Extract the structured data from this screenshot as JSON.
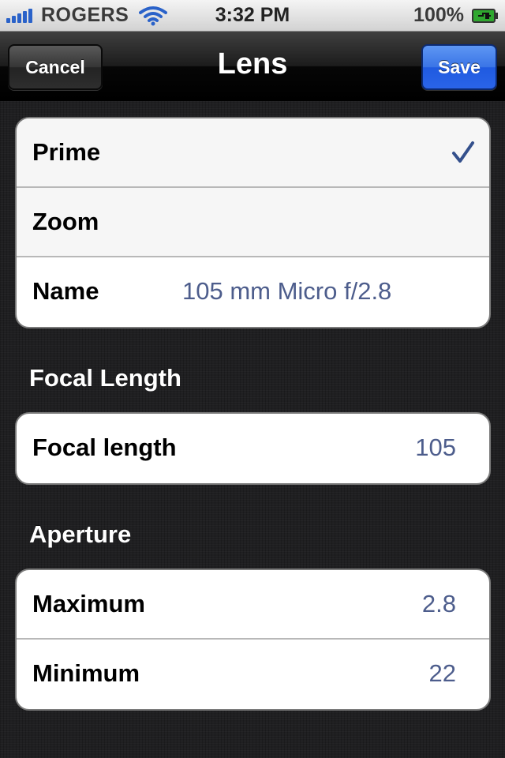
{
  "status_bar": {
    "carrier": "ROGERS",
    "time": "3:32 PM",
    "battery_percent": "100%",
    "icons": [
      "signal-icon",
      "wifi-icon",
      "battery-charging-icon"
    ]
  },
  "nav": {
    "cancel_label": "Cancel",
    "title": "Lens",
    "save_label": "Save",
    "save_color": "#2a64e8"
  },
  "lens_type": {
    "rows": [
      {
        "label": "Prime",
        "checked": true
      },
      {
        "label": "Zoom",
        "checked": false
      }
    ],
    "name": {
      "label": "Name",
      "value": "105 mm Micro f/2.8"
    }
  },
  "focal_length": {
    "header": "Focal Length",
    "row": {
      "label": "Focal length",
      "value": "105"
    }
  },
  "aperture": {
    "header": "Aperture",
    "rows": [
      {
        "label": "Maximum",
        "value": "2.8"
      },
      {
        "label": "Minimum",
        "value": "22"
      }
    ]
  },
  "colors": {
    "value_text": "#4d5d8c",
    "checkmark": "#34508c"
  }
}
